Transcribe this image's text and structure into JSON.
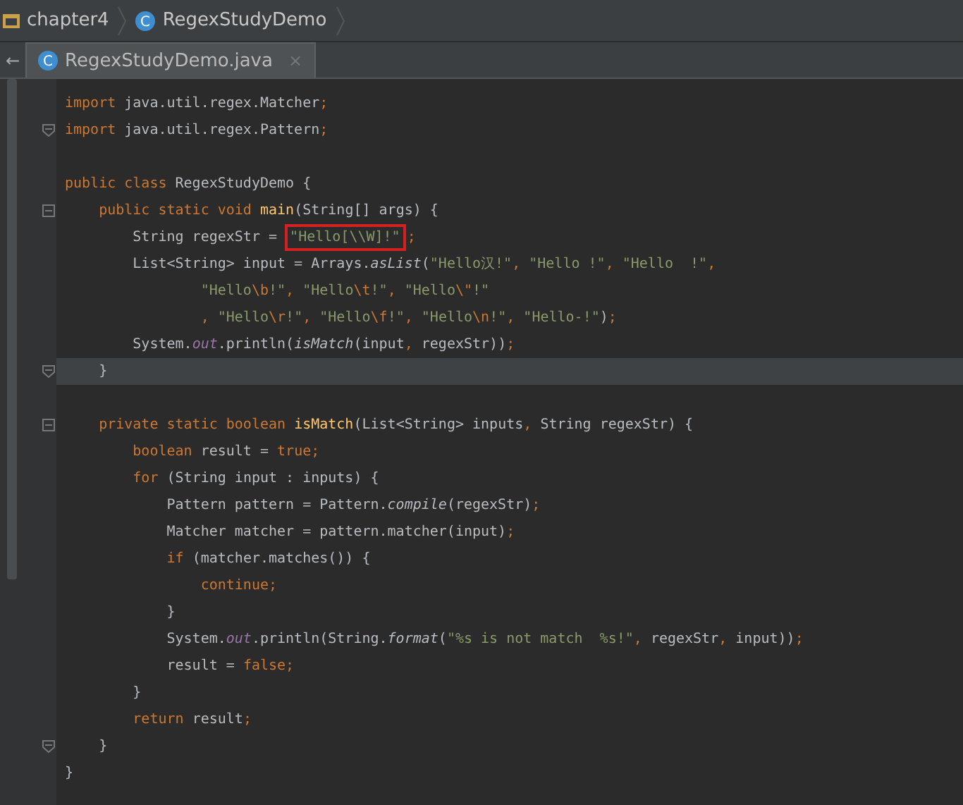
{
  "breadcrumbs": [
    {
      "kind": "folder",
      "label": "chapter4"
    },
    {
      "kind": "class",
      "icon": "C",
      "label": "RegexStudyDemo"
    }
  ],
  "back": "←",
  "tabs": [
    {
      "label": "RegexStudyDemo.java",
      "icon": "C",
      "selected": true,
      "close": "×"
    }
  ],
  "lines": [
    {
      "kind": "code",
      "current": false,
      "tokens": [
        {
          "kind": "kw",
          "text": "import"
        },
        {
          "kind": "plain",
          "text": " java.util.regex.Matcher"
        },
        {
          "kind": "punct",
          "text": ";"
        }
      ]
    },
    {
      "kind": "fold_end",
      "current": false,
      "tokens": [
        {
          "kind": "kw",
          "text": "import"
        },
        {
          "kind": "plain",
          "text": " java.util.regex.Pattern"
        },
        {
          "kind": "punct",
          "text": ";"
        }
      ]
    },
    {
      "kind": "blank"
    },
    {
      "kind": "code",
      "current": false,
      "tokens": [
        {
          "kind": "kw",
          "text": "public class"
        },
        {
          "kind": "plain",
          "text": " RegexStudyDemo {"
        }
      ]
    },
    {
      "kind": "fold_start",
      "current": false,
      "tokens": [
        {
          "kind": "kw",
          "text": "    public static void "
        },
        {
          "kind": "decl",
          "text": "main"
        },
        {
          "kind": "plain",
          "text": "(String[] args) {"
        }
      ]
    },
    {
      "kind": "code",
      "current": false,
      "tokens": [
        {
          "kind": "plain",
          "text": "        String regexStr = "
        },
        {
          "kind": "str",
          "text": "\"Hello[\\\\W]!\"",
          "highlighted": true
        },
        {
          "kind": "punct",
          "text": ";"
        }
      ]
    },
    {
      "kind": "code",
      "current": false,
      "tokens": [
        {
          "kind": "plain",
          "text": "        List<String> input = Arrays."
        },
        {
          "kind": "static",
          "text": "asList"
        },
        {
          "kind": "plain",
          "text": "("
        },
        {
          "kind": "str",
          "text": "\"Hello汉!\""
        },
        {
          "kind": "punct",
          "text": ", "
        },
        {
          "kind": "str",
          "text": "\"Hello !\""
        },
        {
          "kind": "punct",
          "text": ", "
        },
        {
          "kind": "str",
          "text": "\"Hello  !\""
        },
        {
          "kind": "punct",
          "text": ","
        }
      ]
    },
    {
      "kind": "code",
      "current": false,
      "tokens": [
        {
          "kind": "str",
          "text": "                \"Hello"
        },
        {
          "kind": "esc",
          "text": "\\b"
        },
        {
          "kind": "str",
          "text": "!\""
        },
        {
          "kind": "punct",
          "text": ", "
        },
        {
          "kind": "str",
          "text": "\"Hello"
        },
        {
          "kind": "esc",
          "text": "\\t"
        },
        {
          "kind": "str",
          "text": "!\""
        },
        {
          "kind": "punct",
          "text": ", "
        },
        {
          "kind": "str",
          "text": "\"Hello"
        },
        {
          "kind": "esc",
          "text": "\\\""
        },
        {
          "kind": "str",
          "text": "!\""
        }
      ]
    },
    {
      "kind": "code",
      "current": false,
      "tokens": [
        {
          "kind": "punct",
          "text": "                , "
        },
        {
          "kind": "str",
          "text": "\"Hello"
        },
        {
          "kind": "esc",
          "text": "\\r"
        },
        {
          "kind": "str",
          "text": "!\""
        },
        {
          "kind": "punct",
          "text": ", "
        },
        {
          "kind": "str",
          "text": "\"Hello"
        },
        {
          "kind": "esc",
          "text": "\\f"
        },
        {
          "kind": "str",
          "text": "!\""
        },
        {
          "kind": "punct",
          "text": ", "
        },
        {
          "kind": "str",
          "text": "\"Hello"
        },
        {
          "kind": "esc",
          "text": "\\n"
        },
        {
          "kind": "str",
          "text": "!\""
        },
        {
          "kind": "punct",
          "text": ", "
        },
        {
          "kind": "str",
          "text": "\"Hello-!\""
        },
        {
          "kind": "plain",
          "text": ")"
        },
        {
          "kind": "punct",
          "text": ";"
        }
      ]
    },
    {
      "kind": "code",
      "current": false,
      "tokens": [
        {
          "kind": "plain",
          "text": "        System."
        },
        {
          "kind": "field",
          "text": "out"
        },
        {
          "kind": "plain",
          "text": ".println("
        },
        {
          "kind": "static",
          "text": "isMatch"
        },
        {
          "kind": "plain",
          "text": "(input"
        },
        {
          "kind": "punct",
          "text": ", "
        },
        {
          "kind": "plain",
          "text": "regexStr))"
        },
        {
          "kind": "punct",
          "text": ";"
        }
      ]
    },
    {
      "kind": "fold_end",
      "current": true,
      "tokens": [
        {
          "kind": "plain",
          "text": "    }"
        }
      ]
    },
    {
      "kind": "blank"
    },
    {
      "kind": "fold_start",
      "current": false,
      "tokens": [
        {
          "kind": "kw",
          "text": "    private static boolean "
        },
        {
          "kind": "decl",
          "text": "isMatch"
        },
        {
          "kind": "plain",
          "text": "(List<String> inputs"
        },
        {
          "kind": "punct",
          "text": ", "
        },
        {
          "kind": "plain",
          "text": "String regexStr) {"
        }
      ]
    },
    {
      "kind": "code",
      "current": false,
      "tokens": [
        {
          "kind": "kw",
          "text": "        boolean"
        },
        {
          "kind": "plain",
          "text": " result = "
        },
        {
          "kind": "kw",
          "text": "true"
        },
        {
          "kind": "punct",
          "text": ";"
        }
      ]
    },
    {
      "kind": "code",
      "current": false,
      "tokens": [
        {
          "kind": "kw",
          "text": "        for"
        },
        {
          "kind": "plain",
          "text": " (String input : inputs) {"
        }
      ]
    },
    {
      "kind": "code",
      "current": false,
      "tokens": [
        {
          "kind": "plain",
          "text": "            Pattern pattern = Pattern."
        },
        {
          "kind": "static",
          "text": "compile"
        },
        {
          "kind": "plain",
          "text": "(regexStr)"
        },
        {
          "kind": "punct",
          "text": ";"
        }
      ]
    },
    {
      "kind": "code",
      "current": false,
      "tokens": [
        {
          "kind": "plain",
          "text": "            Matcher matcher = pattern.matcher(input)"
        },
        {
          "kind": "punct",
          "text": ";"
        }
      ]
    },
    {
      "kind": "code",
      "current": false,
      "tokens": [
        {
          "kind": "kw",
          "text": "            if"
        },
        {
          "kind": "plain",
          "text": " (matcher.matches()) {"
        }
      ]
    },
    {
      "kind": "code",
      "current": false,
      "tokens": [
        {
          "kind": "kw",
          "text": "                continue"
        },
        {
          "kind": "punct",
          "text": ";"
        }
      ]
    },
    {
      "kind": "code",
      "current": false,
      "tokens": [
        {
          "kind": "plain",
          "text": "            }"
        }
      ]
    },
    {
      "kind": "code",
      "current": false,
      "tokens": [
        {
          "kind": "plain",
          "text": "            System."
        },
        {
          "kind": "field",
          "text": "out"
        },
        {
          "kind": "plain",
          "text": ".println(String."
        },
        {
          "kind": "static",
          "text": "format"
        },
        {
          "kind": "plain",
          "text": "("
        },
        {
          "kind": "str",
          "text": "\"%s is not match  %s!\""
        },
        {
          "kind": "punct",
          "text": ", "
        },
        {
          "kind": "plain",
          "text": "regexStr"
        },
        {
          "kind": "punct",
          "text": ", "
        },
        {
          "kind": "plain",
          "text": "input))"
        },
        {
          "kind": "punct",
          "text": ";"
        }
      ]
    },
    {
      "kind": "code",
      "current": false,
      "tokens": [
        {
          "kind": "plain",
          "text": "            result = "
        },
        {
          "kind": "kw",
          "text": "false"
        },
        {
          "kind": "punct",
          "text": ";"
        }
      ]
    },
    {
      "kind": "code",
      "current": false,
      "tokens": [
        {
          "kind": "plain",
          "text": "        }"
        }
      ]
    },
    {
      "kind": "code",
      "current": false,
      "tokens": [
        {
          "kind": "kw",
          "text": "        return"
        },
        {
          "kind": "plain",
          "text": " result"
        },
        {
          "kind": "punct",
          "text": ";"
        }
      ]
    },
    {
      "kind": "fold_end",
      "current": false,
      "tokens": [
        {
          "kind": "plain",
          "text": "    }"
        }
      ]
    },
    {
      "kind": "code",
      "current": false,
      "tokens": [
        {
          "kind": "plain",
          "text": "}"
        }
      ]
    }
  ]
}
